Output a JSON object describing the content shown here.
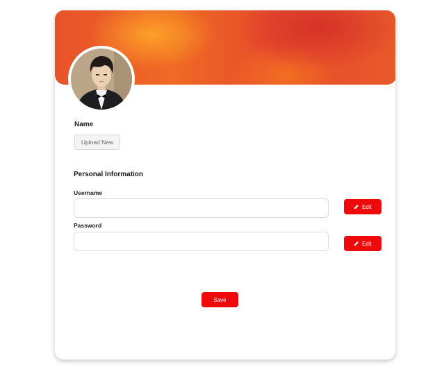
{
  "profile": {
    "name_label": "Name",
    "upload_label": "Upload New",
    "avatar_icon": "user-photo"
  },
  "personal_info": {
    "title": "Personal Information",
    "username_label": "Username",
    "username_value": "",
    "password_label": "Password",
    "password_value": "",
    "edit_label": "Edit",
    "edit_icon": "pencil-icon"
  },
  "actions": {
    "save_label": "Save"
  },
  "colors": {
    "accent": "#ee0a0a",
    "banner_primary": "#e8522a"
  }
}
